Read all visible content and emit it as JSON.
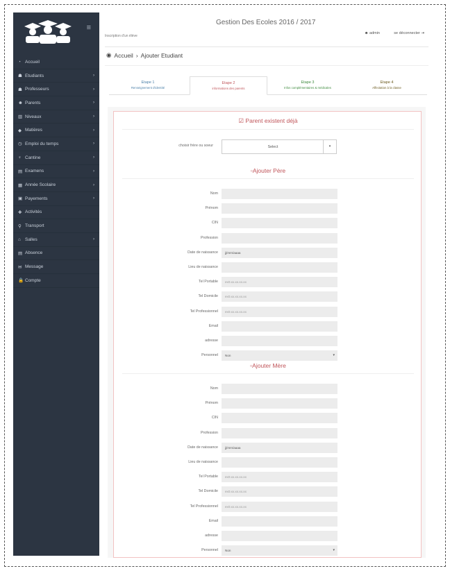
{
  "app": {
    "title": "Gestion Des Ecoles 2016 / 2017",
    "subtitle": "Inscription d'un élève",
    "user": "admin",
    "logout": "se déconnecter"
  },
  "breadcrumb": {
    "home": "Accueil",
    "current": "Ajouter Etudiant"
  },
  "sidebar": {
    "items": [
      {
        "label": "Accueil",
        "icon": "dashboard-icon",
        "glyph": "◔",
        "arrow": false
      },
      {
        "label": "Etudiants",
        "icon": "students-icon",
        "glyph": "☗",
        "arrow": true
      },
      {
        "label": "Professeurs",
        "icon": "teachers-icon",
        "glyph": "☗",
        "arrow": true
      },
      {
        "label": "Parents",
        "icon": "user-icon",
        "glyph": "☻",
        "arrow": true
      },
      {
        "label": "Niveaux",
        "icon": "levels-icon",
        "glyph": "▥",
        "arrow": true
      },
      {
        "label": "Matières",
        "icon": "tags-icon",
        "glyph": "◆",
        "arrow": true
      },
      {
        "label": "Emploi du temps",
        "icon": "clock-icon",
        "glyph": "◷",
        "arrow": true
      },
      {
        "label": "Cantine",
        "icon": "cutlery-icon",
        "glyph": "♆",
        "arrow": true
      },
      {
        "label": "Examens",
        "icon": "exam-icon",
        "glyph": "▤",
        "arrow": true
      },
      {
        "label": "Année Scolaire",
        "icon": "calendar-icon",
        "glyph": "▦",
        "arrow": true
      },
      {
        "label": "Payements",
        "icon": "money-icon",
        "glyph": "▣",
        "arrow": true
      },
      {
        "label": "Activités",
        "icon": "activity-icon",
        "glyph": "✚",
        "arrow": false
      },
      {
        "label": "Transport",
        "icon": "marker-icon",
        "glyph": "⚲",
        "arrow": false
      },
      {
        "label": "Salles",
        "icon": "home-icon",
        "glyph": "⌂",
        "arrow": true
      },
      {
        "label": "Absence",
        "icon": "absence-icon",
        "glyph": "▤",
        "arrow": false
      },
      {
        "label": "Message",
        "icon": "envelope-icon",
        "glyph": "✉",
        "arrow": false
      },
      {
        "label": "Compte",
        "icon": "lock-icon",
        "glyph": "🔒",
        "arrow": false
      }
    ]
  },
  "steps": [
    {
      "title": "Etape 1",
      "sub": "Renseignement d'identité",
      "color": "#4a7fa8"
    },
    {
      "title": "Etape 2",
      "sub": "informations des parents",
      "color": "#c0555a"
    },
    {
      "title": "Etape 3",
      "sub": "Infos complémentaires & médicales",
      "color": "#3d8a3d"
    },
    {
      "title": "Etape 4",
      "sub": "Affectation à la classe",
      "color": "#6b5a1e"
    }
  ],
  "form": {
    "parent_exists": "Parent existent déjà",
    "choose_label": "choisir frère ou soeur",
    "choose_value": "Select",
    "father_title": "Ajouter Père",
    "mother_title": "Ajouter Mère",
    "labels": [
      "Nom",
      "Prénom",
      "CIN",
      "Profession",
      "Date de naissance",
      "Lieu de naissance",
      "Tel Portable",
      "Tel Domicile",
      "Tel Professionnel",
      "Email",
      "adresse",
      "Personnel"
    ],
    "date_placeholder": "jj/mm/aaaa",
    "phone_placeholder": "ex0.xx.xx.xx.xx",
    "personnel_value": "Non"
  }
}
